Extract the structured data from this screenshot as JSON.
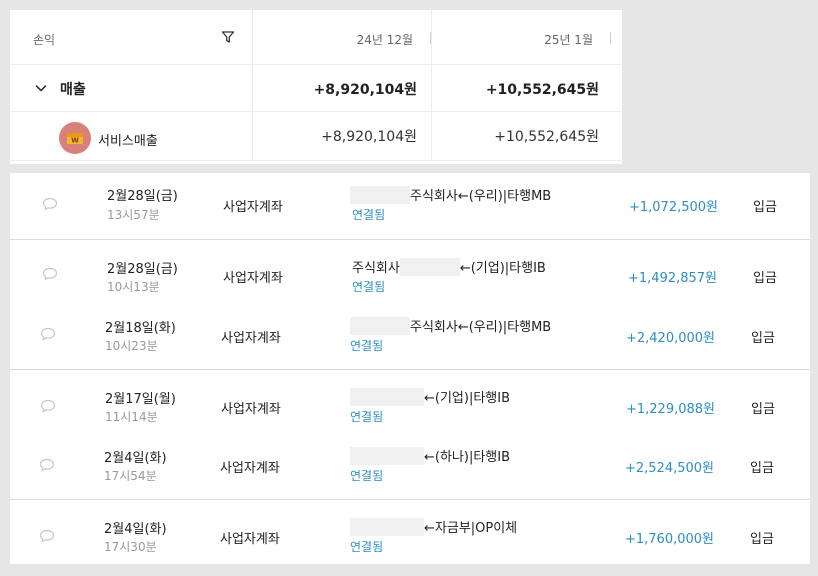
{
  "income": {
    "header": {
      "label": "손익",
      "periods": [
        "24년 12월",
        "25년 1월"
      ]
    },
    "sales": {
      "label": "매출",
      "amounts": [
        "+8,920,104원",
        "+10,552,645원"
      ]
    },
    "service": {
      "label": "서비스매출",
      "amounts": [
        "+8,920,104원",
        "+10,552,645원"
      ]
    }
  },
  "transactions": [
    {
      "date": "2월28일(금)",
      "time": "13시57분",
      "account": "사업자계좌",
      "counterpart": "주식회사←(우리)|타행MB",
      "link": "연결됨",
      "amount": "+1,072,500원",
      "kind": "입금"
    },
    {
      "date": "2월28일(금)",
      "time": "10시13분",
      "account": "사업자계좌",
      "counterpart_prefix": "주식회사",
      "counterpart": "←(기업)|타행IB",
      "link": "연결됨",
      "amount": "+1,492,857원",
      "kind": "입금"
    },
    {
      "date": "2월18일(화)",
      "time": "10시23분",
      "account": "사업자계좌",
      "counterpart": "주식회사←(우리)|타행MB",
      "link": "연결됨",
      "amount": "+2,420,000원",
      "kind": "입금"
    },
    {
      "date": "2월17일(월)",
      "time": "11시14분",
      "account": "사업자계좌",
      "counterpart": "←(기업)|타행IB",
      "link": "연결됨",
      "amount": "+1,229,088원",
      "kind": "입금"
    },
    {
      "date": "2월4일(화)",
      "time": "17시54분",
      "account": "사업자계좌",
      "counterpart": "←(하나)|타행IB",
      "link": "연결됨",
      "amount": "+2,524,500원",
      "kind": "입금"
    },
    {
      "date": "2월4일(화)",
      "time": "17시30분",
      "account": "사업자계좌",
      "counterpart": "←자금부|OP이체",
      "link": "연결됨",
      "amount": "+1,760,000원",
      "kind": "입금"
    }
  ],
  "colors": {
    "link": "#2d8ec2",
    "amount": "#2d8ec2",
    "service_icon": "#d9807a"
  },
  "icons": {
    "filter": "filter-icon",
    "chevron": "chevron-down-icon",
    "service": "wallet-icon",
    "memo": "speech-bubble-icon"
  }
}
